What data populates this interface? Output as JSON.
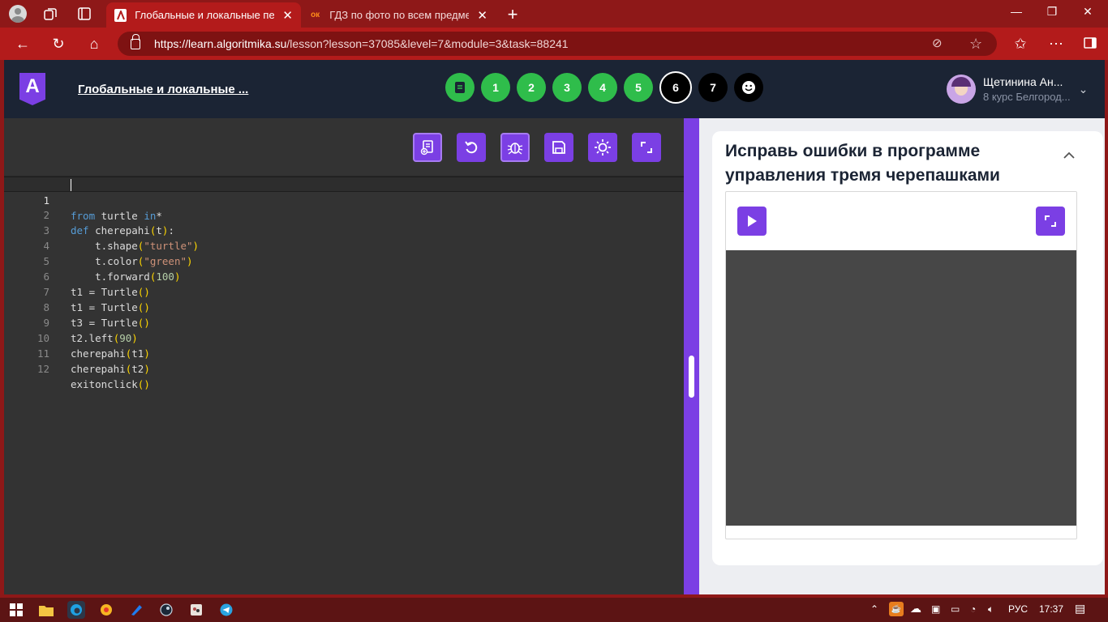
{
  "browser": {
    "tabs": [
      {
        "title": "Глобальные и локальные перем",
        "favicon": "algoritmika-favicon",
        "active": true
      },
      {
        "title": "ГДЗ по фото по всем предметам",
        "favicon": "ok-favicon",
        "active": false
      }
    ],
    "favicon_text_ok": "ок",
    "close_glyph": "✕",
    "url_host": "https://learn.algoritmika.su",
    "url_path": "/lesson?lesson=37085&level=7&module=3&task=88241"
  },
  "header": {
    "logo_letter": "A",
    "lesson_title": "Глобальные и локальные ...",
    "steps": [
      {
        "label": "",
        "state": "done",
        "icon": "document-icon"
      },
      {
        "label": "1",
        "state": "done"
      },
      {
        "label": "2",
        "state": "done"
      },
      {
        "label": "3",
        "state": "done"
      },
      {
        "label": "4",
        "state": "done"
      },
      {
        "label": "5",
        "state": "done"
      },
      {
        "label": "6",
        "state": "current"
      },
      {
        "label": "7",
        "state": "todo"
      },
      {
        "label": "",
        "state": "todo",
        "icon": "smiley-icon"
      }
    ],
    "user_name": "Щетинина Ан...",
    "user_course": "8 курс Белгород..."
  },
  "editor": {
    "toolbar_icons": [
      "add-file-icon",
      "undo-icon",
      "debug-icon",
      "save-icon",
      "theme-icon",
      "expand-icon"
    ],
    "line_numbers": [
      "1",
      "2",
      "3",
      "4",
      "5",
      "6",
      "7",
      "8",
      "9",
      "10",
      "11",
      "12"
    ],
    "code": {
      "l1_kw1": "from",
      "l1_mid": " turtle ",
      "l1_kw2": "in",
      "l1_end": "*",
      "l2_kw": "def",
      "l2_name": " cherepahi",
      "l2_p1": "(",
      "l2_arg": "t",
      "l2_p2": ")",
      "l2_end": ":",
      "l3_pre": "    t.shape",
      "l3_p1": "(",
      "l3_str": "\"turtle\"",
      "l3_p2": ")",
      "l4_pre": "    t.color",
      "l4_p1": "(",
      "l4_str": "\"green\"",
      "l4_p2": ")",
      "l5_pre": "    t.forward",
      "l5_p1": "(",
      "l5_num": "100",
      "l5_p2": ")",
      "l6": "t1 = Turtle",
      "l7": "t1 = Turtle",
      "l8": "t3 = Turtle",
      "pp": "()",
      "l9_pre": "t2.left",
      "l9_p1": "(",
      "l9_num": "90",
      "l9_p2": ")",
      "l10_pre": "cherepahi",
      "l10_p1": "(",
      "l10_arg": "t1",
      "l10_p2": ")",
      "l11_pre": "cherepahi",
      "l11_p1": "(",
      "l11_arg": "t2",
      "l11_p2": ")",
      "l12_pre": "exitonclick"
    }
  },
  "task": {
    "title": "Исправь ошибки в программе управления тремя черепашками",
    "collapse_glyph": "︿"
  },
  "system": {
    "language": "РУС",
    "time": "17:37"
  },
  "colors": {
    "accent": "#7b3fe4",
    "done_step": "#2fbd4b",
    "browser_frame": "#b31b1b",
    "editor_bg": "#333333"
  }
}
